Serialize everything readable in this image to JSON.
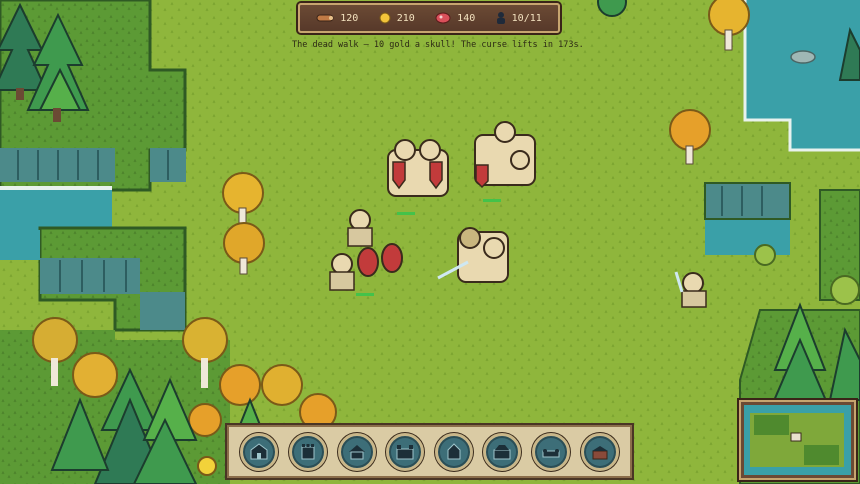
{
  "hud": {
    "resources": [
      {
        "icon": "wood-log-icon",
        "value": "120"
      },
      {
        "icon": "gold-coin-icon",
        "value": "210"
      },
      {
        "icon": "meat-icon",
        "value": "140"
      },
      {
        "icon": "population-icon",
        "value": "10/11"
      }
    ]
  },
  "message": "The dead walk — 10 gold a skull! The curse lifts in 173s.",
  "actionbar": {
    "slots": [
      {
        "icon": "barracks-icon"
      },
      {
        "icon": "tower-icon"
      },
      {
        "icon": "house-icon"
      },
      {
        "icon": "castle-icon"
      },
      {
        "icon": "archery-icon"
      },
      {
        "icon": "farm-icon"
      },
      {
        "icon": "wall-icon"
      },
      {
        "icon": "market-icon"
      }
    ]
  },
  "colors": {
    "grass": "#8fb63c",
    "grass_dark": "#5e8f2e",
    "water": "#3aa0a8",
    "cliff": "#4c8a8a",
    "hud_wood": "#6b4a34",
    "hud_trim": "#c7a56f"
  }
}
